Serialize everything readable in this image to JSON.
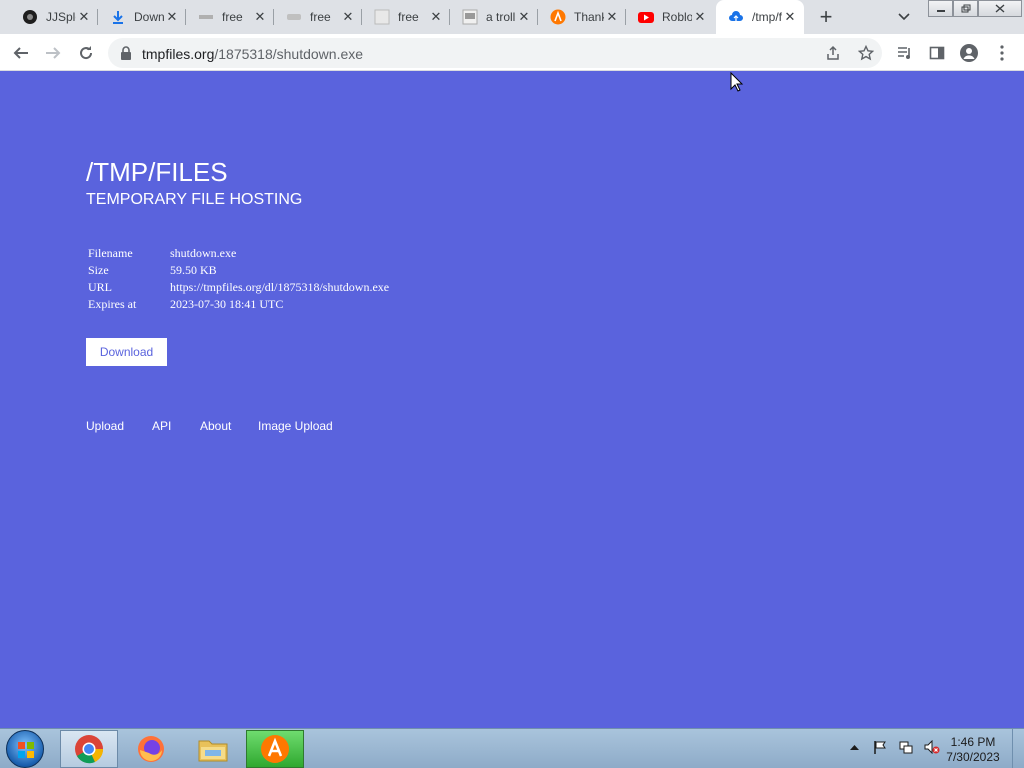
{
  "browser": {
    "tabs": [
      {
        "title": "JJSploit",
        "icon": "jjsploit-icon"
      },
      {
        "title": "Download",
        "icon": "download-icon"
      },
      {
        "title": "free",
        "icon": "site-icon"
      },
      {
        "title": "free",
        "icon": "ios-icon"
      },
      {
        "title": "free",
        "icon": "search-site-icon"
      },
      {
        "title": "a troll",
        "icon": "thumbnail-icon"
      },
      {
        "title": "Thanks",
        "icon": "avast-icon"
      },
      {
        "title": "Roblox",
        "icon": "youtube-icon"
      },
      {
        "title": "/tmp/files",
        "icon": "upload-cloud-icon",
        "active": true
      }
    ],
    "url_host": "tmpfiles.org",
    "url_path": "/1875318/shutdown.exe"
  },
  "page": {
    "title": "/TMP/FILES",
    "subtitle": "TEMPORARY FILE HOSTING",
    "info": [
      {
        "label": "Filename",
        "value": "shutdown.exe"
      },
      {
        "label": "Size",
        "value": "59.50 KB"
      },
      {
        "label": "URL",
        "value": "https://tmpfiles.org/dl/1875318/shutdown.exe"
      },
      {
        "label": "Expires at",
        "value": "2023-07-30 18:41 UTC"
      }
    ],
    "download_label": "Download",
    "footer_links": [
      "Upload",
      "API",
      "About",
      "Image Upload"
    ],
    "background_color": "#5a63dd"
  },
  "taskbar": {
    "apps": [
      "chrome-icon",
      "firefox-icon",
      "file-explorer-icon",
      "avast-icon"
    ],
    "time": "1:46 PM",
    "date": "7/30/2023"
  }
}
